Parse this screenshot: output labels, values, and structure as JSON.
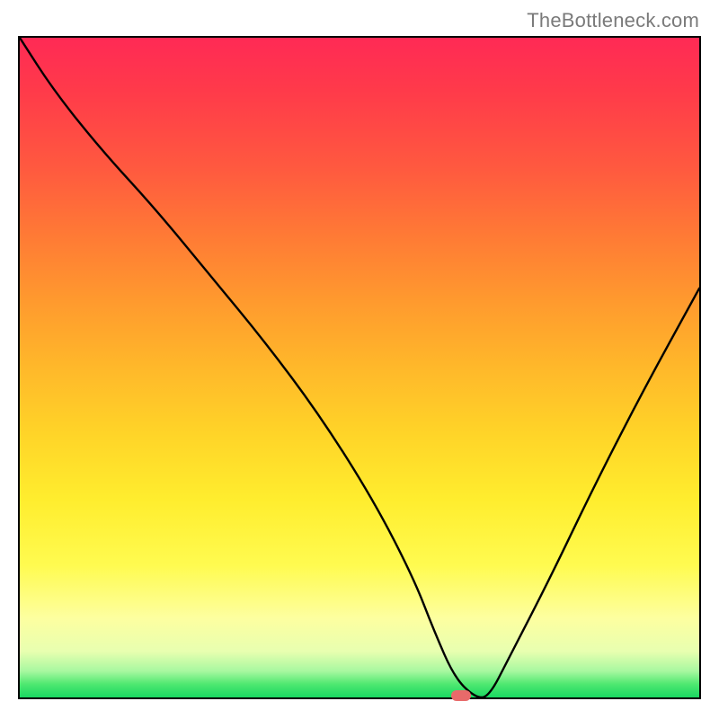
{
  "watermark": "TheBottleneck.com",
  "chart_data": {
    "type": "line",
    "title": "",
    "xlabel": "",
    "ylabel": "",
    "xlim": [
      0,
      100
    ],
    "ylim": [
      0,
      100
    ],
    "grid": false,
    "legend": false,
    "background_gradient": {
      "top": "#ff2a55",
      "upper_mid": "#ffb82a",
      "lower_mid": "#ffed2e",
      "bottom": "#19d862"
    },
    "series": [
      {
        "name": "bottleneck-curve",
        "color": "#000000",
        "x": [
          0,
          5,
          12,
          20,
          28,
          36,
          44,
          52,
          58,
          61,
          64,
          67,
          69,
          72,
          78,
          85,
          92,
          100
        ],
        "values": [
          100,
          92,
          83,
          74,
          64,
          54,
          43,
          30,
          18,
          10,
          3,
          0,
          0,
          6,
          18,
          33,
          47,
          62
        ]
      }
    ],
    "marker": {
      "name": "optimal-point",
      "x": 65,
      "y": 0,
      "color": "#e86a6a"
    }
  }
}
